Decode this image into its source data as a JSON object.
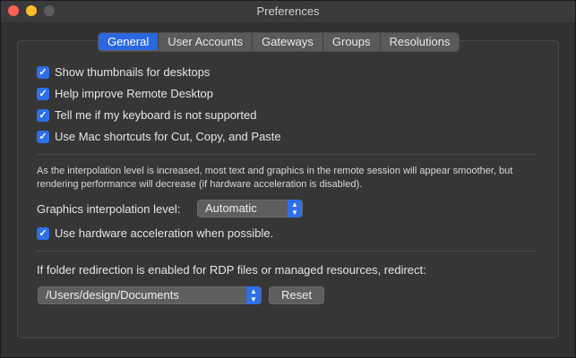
{
  "window": {
    "title": "Preferences"
  },
  "tabs": [
    {
      "label": "General"
    },
    {
      "label": "User Accounts"
    },
    {
      "label": "Gateways"
    },
    {
      "label": "Groups"
    },
    {
      "label": "Resolutions"
    }
  ],
  "active_tab": "General",
  "checkboxes": [
    {
      "label": "Show thumbnails for desktops",
      "checked": true
    },
    {
      "label": "Help improve Remote Desktop",
      "checked": true
    },
    {
      "label": "Tell me if my keyboard is not supported",
      "checked": true
    },
    {
      "label": "Use Mac shortcuts for Cut, Copy, and Paste",
      "checked": true
    }
  ],
  "interpolation": {
    "note": "As the interpolation level is increased, most text and graphics in the remote session will appear smoother, but rendering performance will decrease (if hardware acceleration is disabled).",
    "label": "Graphics interpolation level:",
    "value": "Automatic"
  },
  "hardware_acceleration": {
    "label": "Use hardware acceleration when possible.",
    "checked": true
  },
  "redirection": {
    "label": "If folder redirection is enabled for RDP files or managed resources, redirect:",
    "path": "/Users/design/Documents",
    "reset_label": "Reset"
  },
  "icons": {
    "check": "checkmark-icon",
    "popup_arrows": "chevron-up-down-icon"
  },
  "colors": {
    "accent": "#2e6fe8",
    "tab_active": "#2b67e0"
  }
}
